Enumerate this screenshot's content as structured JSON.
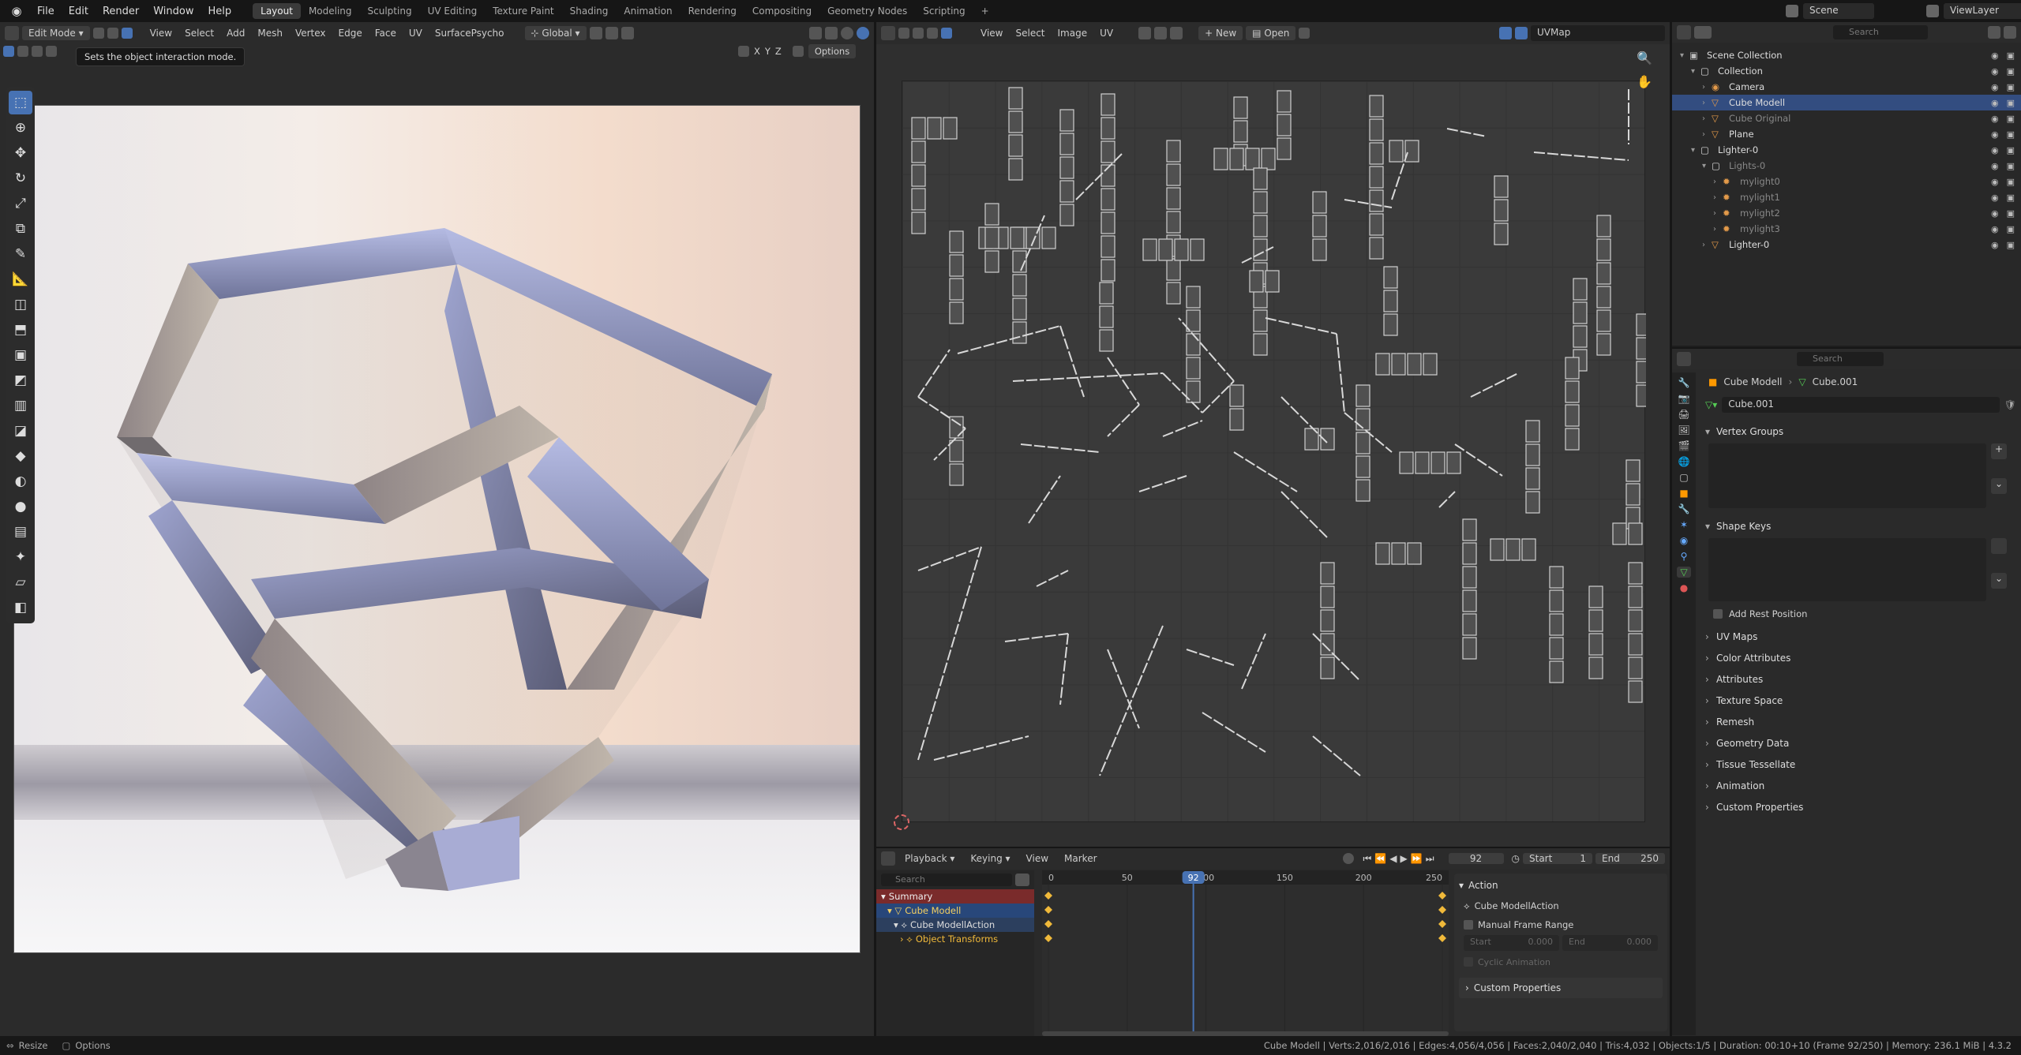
{
  "menu": {
    "file": "File",
    "edit": "Edit",
    "render": "Render",
    "window": "Window",
    "help": "Help"
  },
  "workspaces": [
    {
      "label": "Layout",
      "active": true
    },
    {
      "label": "Modeling"
    },
    {
      "label": "Sculpting"
    },
    {
      "label": "UV Editing"
    },
    {
      "label": "Texture Paint"
    },
    {
      "label": "Shading"
    },
    {
      "label": "Animation"
    },
    {
      "label": "Rendering"
    },
    {
      "label": "Compositing"
    },
    {
      "label": "Geometry Nodes"
    },
    {
      "label": "Scripting"
    },
    {
      "label": "+"
    }
  ],
  "scene": {
    "label": "Scene",
    "viewlayer": "ViewLayer"
  },
  "viewport": {
    "mode": "Edit Mode",
    "menus": [
      "View",
      "Select",
      "Add",
      "Mesh",
      "Vertex",
      "Edge",
      "Face",
      "UV",
      "SurfacePsycho"
    ],
    "orientation": "Global",
    "axes": [
      "X",
      "Y",
      "Z"
    ],
    "options": "Options",
    "tooltip": "Sets the object interaction mode."
  },
  "uv_editor": {
    "menus": [
      "View",
      "Select",
      "Image",
      "UV"
    ],
    "new": "New",
    "open": "Open",
    "uvmap": "UVMap"
  },
  "outliner": {
    "search_placeholder": "Search",
    "rows": [
      {
        "label": "Scene Collection",
        "indent": 0,
        "type": "root"
      },
      {
        "label": "Collection",
        "indent": 1,
        "type": "collection"
      },
      {
        "label": "Camera",
        "indent": 2,
        "type": "camera"
      },
      {
        "label": "Cube Modell",
        "indent": 2,
        "type": "mesh",
        "selected": true
      },
      {
        "label": "Cube Original",
        "indent": 2,
        "type": "mesh",
        "dim": true
      },
      {
        "label": "Plane",
        "indent": 2,
        "type": "mesh"
      },
      {
        "label": "Lighter-0",
        "indent": 1,
        "type": "collection"
      },
      {
        "label": "Lights-0",
        "indent": 2,
        "type": "collection",
        "dim": true
      },
      {
        "label": "mylight0",
        "indent": 3,
        "type": "light",
        "dim": true
      },
      {
        "label": "mylight1",
        "indent": 3,
        "type": "light",
        "dim": true
      },
      {
        "label": "mylight2",
        "indent": 3,
        "type": "light",
        "dim": true
      },
      {
        "label": "mylight3",
        "indent": 3,
        "type": "light",
        "dim": true
      },
      {
        "label": "Lighter-0",
        "indent": 2,
        "type": "mesh"
      }
    ]
  },
  "properties": {
    "search_placeholder": "Search",
    "breadcrumb": [
      "Cube Modell",
      "Cube.001"
    ],
    "mesh_name": "Cube.001",
    "vertex_groups": "Vertex Groups",
    "shape_keys": "Shape Keys",
    "add_rest_position": "Add Rest Position",
    "panels": [
      "UV Maps",
      "Color Attributes",
      "Attributes",
      "Texture Space",
      "Remesh",
      "Geometry Data",
      "Tissue Tessellate",
      "Animation",
      "Custom Properties"
    ]
  },
  "timeline": {
    "menus": [
      "Playback",
      "Keying",
      "View",
      "Marker"
    ],
    "current_frame": "92",
    "start_label": "Start",
    "start": "1",
    "end_label": "End",
    "end": "250",
    "search_placeholder": "Search",
    "ticks": [
      "0",
      "50",
      "100",
      "150",
      "200",
      "250"
    ],
    "playhead": "92",
    "channels": [
      {
        "label": "Summary",
        "kind": "summary"
      },
      {
        "label": "Cube Modell",
        "kind": "object"
      },
      {
        "label": "Cube ModellAction",
        "kind": "action"
      },
      {
        "label": "Object Transforms",
        "kind": "group"
      }
    ],
    "action_panel": {
      "title": "Action",
      "action_name": "Cube ModellAction",
      "manual_range": "Manual Frame Range",
      "start_label": "Start",
      "start_val": "0.000",
      "end_label": "End",
      "end_val": "0.000",
      "cyclic": "Cyclic Animation",
      "custom_props": "Custom Properties"
    }
  },
  "status": {
    "left_resize": "Resize",
    "left_options": "Options",
    "stats": "Cube Modell | Verts:2,016/2,016 | Edges:4,056/4,056 | Faces:2,040/2,040 | Tris:4,032 | Objects:1/5 | Duration: 00:10+10 (Frame 92/250) | Memory: 236.1 MiB | 4.3.2"
  },
  "colors": {
    "accent": "#4772b3",
    "keyframe": "#f0b93a",
    "selected_row": "#334d80"
  }
}
